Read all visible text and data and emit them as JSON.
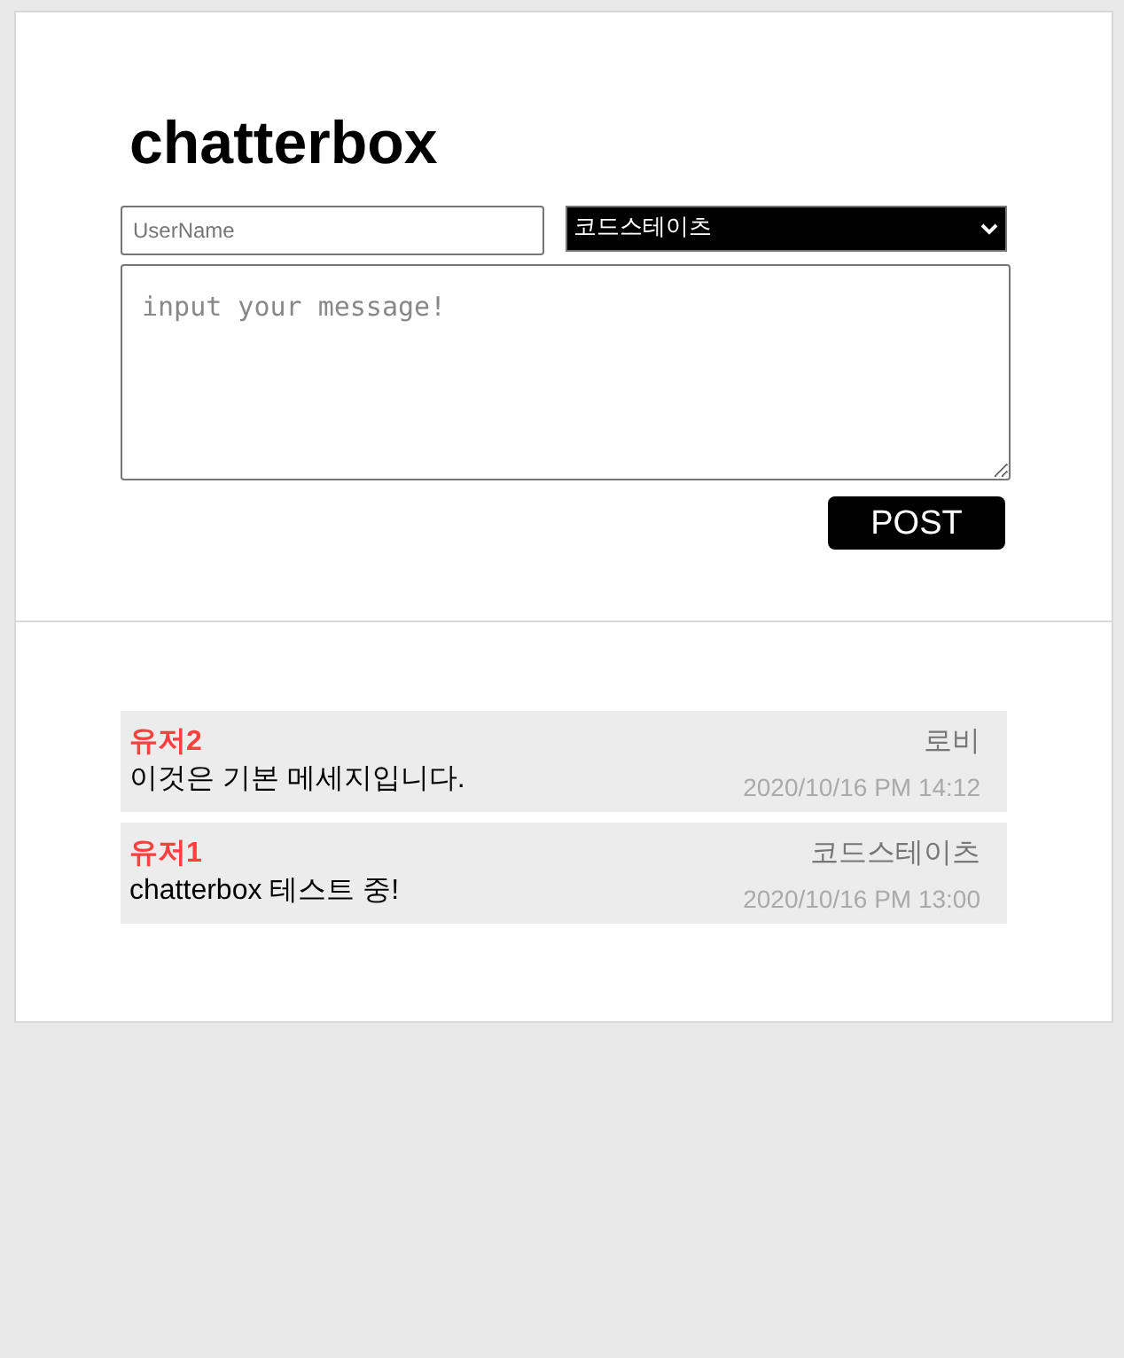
{
  "title": "chatterbox",
  "username_field": {
    "placeholder": "UserName"
  },
  "room_select": {
    "value": "코드스테이츠"
  },
  "message_field": {
    "placeholder": "input your message!"
  },
  "post_button": "POST",
  "messages": [
    {
      "username": "유저2",
      "text": "이것은 기본 메세지입니다.",
      "room": "로비",
      "date": "2020/10/16 PM 14:12"
    },
    {
      "username": "유저1",
      "text": "chatterbox 테스트 중!",
      "room": "코드스테이츠",
      "date": "2020/10/16 PM 13:00"
    }
  ]
}
